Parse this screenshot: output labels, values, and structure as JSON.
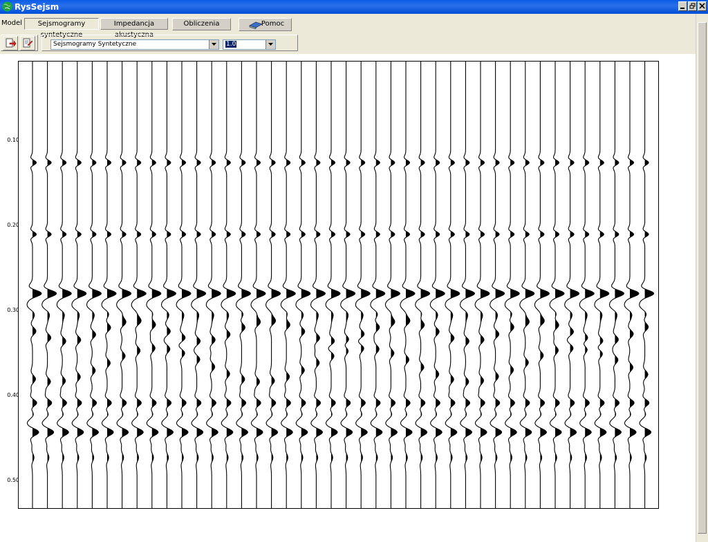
{
  "window": {
    "title": "RysSejsm"
  },
  "tabs": [
    {
      "label": "Model"
    },
    {
      "label": "Sejsmogramy syntetyczne"
    },
    {
      "label": "Impedancja akustyczna"
    },
    {
      "label": "Obliczenia"
    },
    {
      "label": "Pomoc"
    }
  ],
  "toolbar": {
    "view_select": "Sejsmogramy Syntetyczne",
    "scale_select": "1.0"
  },
  "axis": {
    "y_ticks": [
      "0.10",
      "0.20",
      "0.30",
      "0.40",
      "0.50"
    ]
  },
  "seismogram": {
    "trace_count": 43,
    "t_min": 0.01,
    "t_max": 0.54,
    "events": [
      0.13,
      0.215,
      0.285,
      0.45
    ]
  }
}
